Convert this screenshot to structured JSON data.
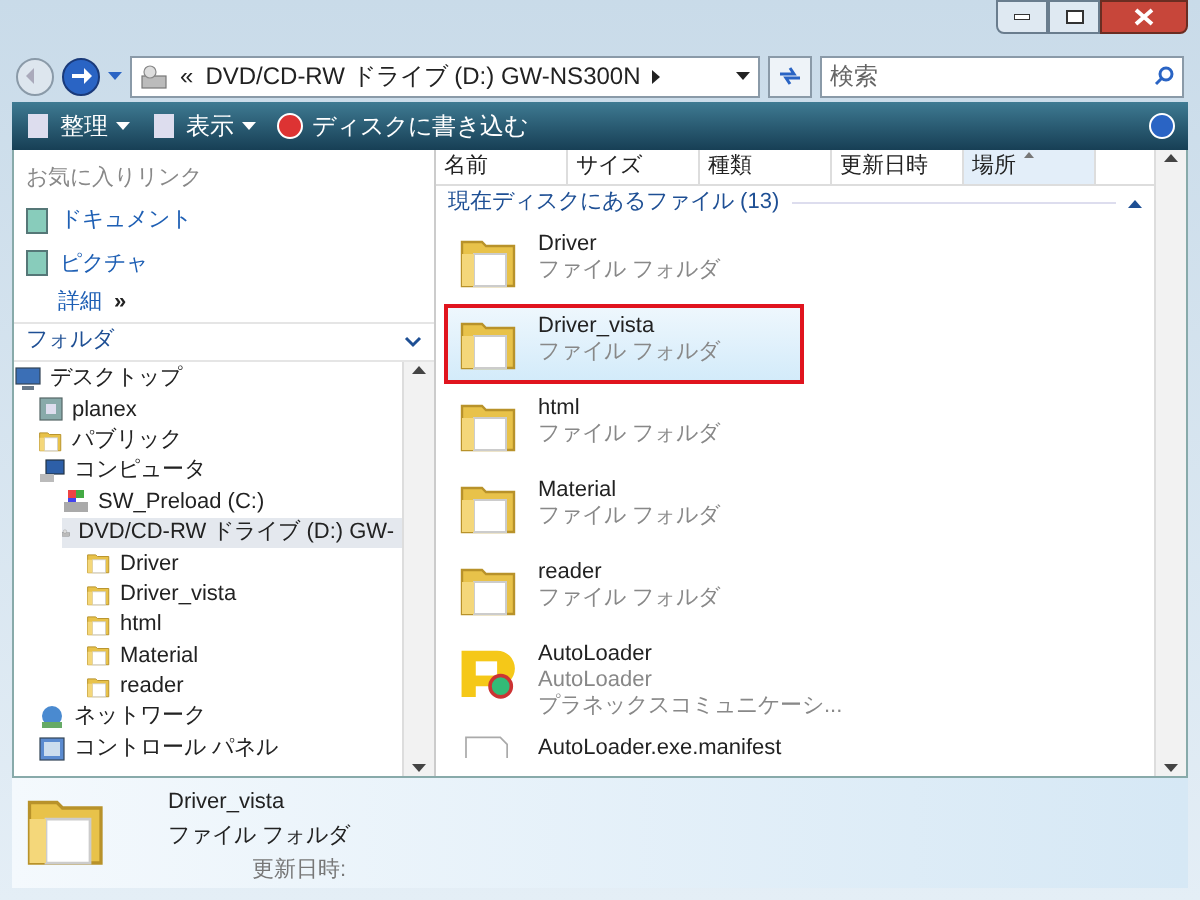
{
  "address_bar": {
    "path": "DVD/CD-RW ドライブ (D:) GW-NS300N",
    "chevron": "«"
  },
  "search": {
    "placeholder": "検索"
  },
  "toolbar": [
    {
      "label": "整理",
      "kind": "menu"
    },
    {
      "label": "表示",
      "kind": "menu"
    },
    {
      "label": "ディスクに書き込む",
      "kind": "burn"
    }
  ],
  "favorites": {
    "title": "お気に入りリンク",
    "items": [
      {
        "label": "ドキュメント"
      },
      {
        "label": "ピクチャ"
      }
    ],
    "more": "詳細",
    "more_arrow": "»"
  },
  "folders": {
    "title": "フォルダ",
    "tree": [
      {
        "label": "デスクトップ",
        "kind": "desktop",
        "selected": false,
        "children": [
          {
            "label": "planex",
            "kind": "user",
            "selected": false
          },
          {
            "label": "パブリック",
            "kind": "folder",
            "selected": false
          },
          {
            "label": "コンピュータ",
            "kind": "computer",
            "selected": false,
            "children": [
              {
                "label": "SW_Preload (C:)",
                "kind": "drive",
                "selected": false
              },
              {
                "label": "DVD/CD-RW ドライブ (D:) GW-",
                "kind": "dvd",
                "selected": true,
                "children": [
                  {
                    "label": "Driver",
                    "kind": "folder",
                    "selected": false
                  },
                  {
                    "label": "Driver_vista",
                    "kind": "folder",
                    "selected": false
                  },
                  {
                    "label": "html",
                    "kind": "folder",
                    "selected": false
                  },
                  {
                    "label": "Material",
                    "kind": "folder",
                    "selected": false
                  },
                  {
                    "label": "reader",
                    "kind": "folder",
                    "selected": false
                  }
                ]
              }
            ]
          },
          {
            "label": "ネットワーク",
            "kind": "network",
            "selected": false
          },
          {
            "label": "コントロール パネル",
            "kind": "control",
            "selected": false
          }
        ]
      }
    ]
  },
  "columns": [
    {
      "label": "名前",
      "sorted": false
    },
    {
      "label": "サイズ",
      "sorted": false
    },
    {
      "label": "種類",
      "sorted": false
    },
    {
      "label": "更新日時",
      "sorted": false
    },
    {
      "label": "場所",
      "sorted": true
    }
  ],
  "group": {
    "title": "現在ディスクにあるファイル (13)"
  },
  "files": [
    {
      "name": "Driver",
      "lines": [
        "ファイル フォルダ"
      ],
      "kind": "folder",
      "selected": false,
      "annotated": false
    },
    {
      "name": "Driver_vista",
      "lines": [
        "ファイル フォルダ"
      ],
      "kind": "folder",
      "selected": true,
      "annotated": true
    },
    {
      "name": "html",
      "lines": [
        "ファイル フォルダ"
      ],
      "kind": "folder",
      "selected": false,
      "annotated": false
    },
    {
      "name": "Material",
      "lines": [
        "ファイル フォルダ"
      ],
      "kind": "folder",
      "selected": false,
      "annotated": false
    },
    {
      "name": "reader",
      "lines": [
        "ファイル フォルダ"
      ],
      "kind": "folder",
      "selected": false,
      "annotated": false
    },
    {
      "name": "AutoLoader",
      "lines": [
        "AutoLoader",
        "プラネックスコミュニケーシ..."
      ],
      "kind": "app",
      "selected": false,
      "annotated": false
    },
    {
      "name": "AutoLoader.exe.manifest",
      "kind": "file",
      "selected": false,
      "annotated": false
    }
  ],
  "details": {
    "name": "Driver_vista",
    "type": "ファイル フォルダ",
    "date_label": "更新日時:"
  }
}
